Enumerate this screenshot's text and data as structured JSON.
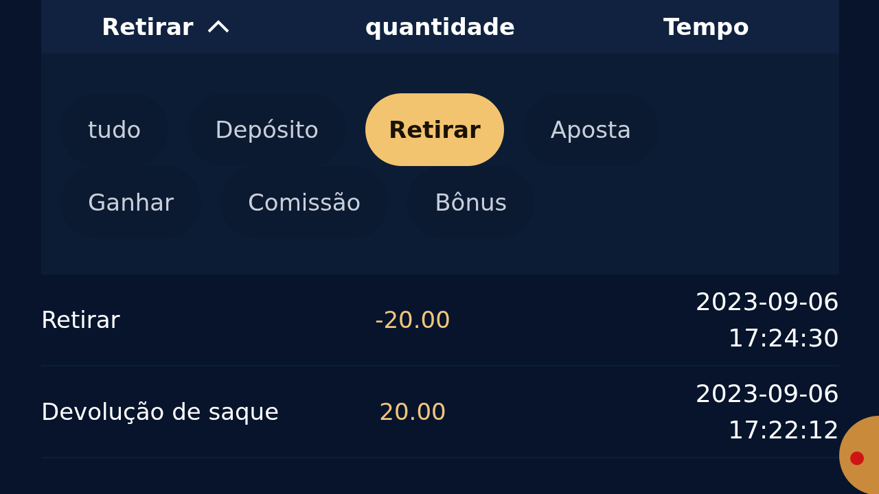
{
  "header": {
    "columns": [
      {
        "label": "Retirar",
        "expanded": true
      },
      {
        "label": "quantidade"
      },
      {
        "label": "Tempo"
      }
    ]
  },
  "filters": [
    {
      "label": "tudo",
      "selected": false
    },
    {
      "label": "Depósito",
      "selected": false
    },
    {
      "label": "Retirar",
      "selected": true
    },
    {
      "label": "Aposta",
      "selected": false
    },
    {
      "label": "Ganhar",
      "selected": false
    },
    {
      "label": "Comissão",
      "selected": false
    },
    {
      "label": "Bônus",
      "selected": false
    }
  ],
  "records": [
    {
      "type": "Retirar",
      "amount": "-20.00",
      "date": "2023-09-06",
      "time": "17:24:30"
    },
    {
      "type": "Devolução de saque",
      "amount": "20.00",
      "date": "2023-09-06",
      "time": "17:22:12"
    }
  ]
}
